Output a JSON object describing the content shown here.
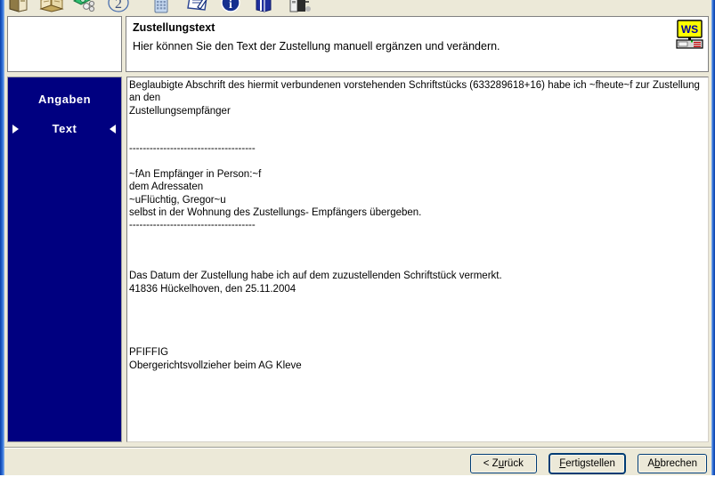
{
  "window": {
    "frame_color": "#1e5fbf",
    "page_background": "#ece9d8"
  },
  "toolbar": {
    "icons": [
      {
        "name": "book-closed-icon",
        "tooltip": "Akte"
      },
      {
        "name": "book-open-icon",
        "tooltip": "Buch"
      },
      {
        "name": "money-coins-icon",
        "tooltip": "Kosten"
      },
      {
        "name": "number-two-icon",
        "tooltip": "2"
      },
      {
        "name": "calculator-icon",
        "tooltip": "Rechner"
      },
      {
        "name": "notepad-pen-icon",
        "tooltip": "Notiz"
      },
      {
        "name": "info-circle-icon",
        "tooltip": "Info"
      },
      {
        "name": "book-blue-icon",
        "tooltip": "Nachschlagen"
      },
      {
        "name": "file-cabinet-icon",
        "tooltip": "Archiv"
      }
    ]
  },
  "header": {
    "title": "Zustellungstext",
    "subtitle": "Hier können Sie den Text der Zustellung manuell ergänzen und verändern.",
    "logo_box_empty": true,
    "ws_logo": {
      "name": "ws-monitor-logo",
      "text": "WS",
      "screen_color": "#ffff00",
      "text_color": "#0000a0"
    }
  },
  "sidebar": {
    "background": "#000080",
    "items": [
      {
        "label": "Angaben",
        "selected": false
      },
      {
        "label": "Text",
        "selected": true
      }
    ]
  },
  "editor": {
    "name": "zustellungstext-editor",
    "content": "Beglaubigte Abschrift des hiermit verbundenen vorstehenden Schriftstücks (633289618+16) habe ich ~fheute~f zur Zustellung an den\nZustellungsempfänger\n\n\n-------------------------------------\n\n~fAn Empfänger in Person:~f\ndem Adressaten\n~uFlüchtig, Gregor~u\nselbst in der Wohnung des Zustellungs- Empfängers übergeben.\n-------------------------------------\n\n\n\nDas Datum der Zustellung habe ich auf dem zuzustellenden Schriftstück vermerkt.\n41836 Hückelhoven, den 25.11.2004\n\n\n\n\nPFIFFIG\nObergerichtsvollzieher beim AG Kleve"
  },
  "footer": {
    "buttons": [
      {
        "name": "back-button",
        "label_before": "< Z",
        "accel": "u",
        "label_after": "rück",
        "focused": false
      },
      {
        "name": "finish-button",
        "label_before": "",
        "accel": "F",
        "label_after": "ertigstellen",
        "focused": true
      },
      {
        "name": "cancel-button",
        "label_before": "A",
        "accel": "b",
        "label_after": "brechen",
        "focused": false
      }
    ]
  }
}
